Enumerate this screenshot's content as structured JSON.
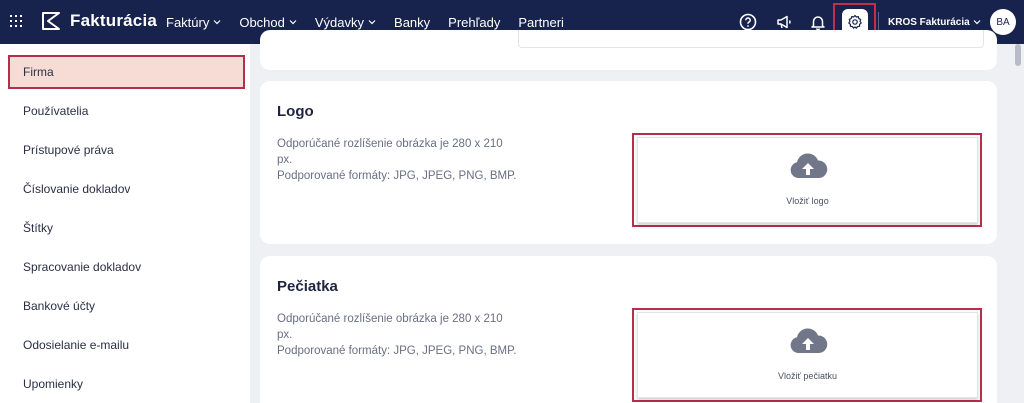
{
  "brand": {
    "name": "Fakturácia"
  },
  "nav": [
    {
      "label": "Faktúry",
      "dropdown": true
    },
    {
      "label": "Obchod",
      "dropdown": true
    },
    {
      "label": "Výdavky",
      "dropdown": true
    },
    {
      "label": "Banky",
      "dropdown": false
    },
    {
      "label": "Prehľady",
      "dropdown": false
    },
    {
      "label": "Partneri",
      "dropdown": false
    }
  ],
  "toolbar": {
    "icons": [
      "help-icon",
      "megaphone-icon",
      "bell-icon",
      "gear-icon"
    ],
    "company": "KROS Fakturácia",
    "avatar_initials": "BA"
  },
  "sidebar": {
    "items": [
      {
        "label": "Firma",
        "active": true
      },
      {
        "label": "Používatelia"
      },
      {
        "label": "Prístupové práva"
      },
      {
        "label": "Číslovanie dokladov"
      },
      {
        "label": "Štítky"
      },
      {
        "label": "Spracovanie dokladov"
      },
      {
        "label": "Bankové účty"
      },
      {
        "label": "Odosielanie e-mailu"
      },
      {
        "label": "Upomienky"
      }
    ]
  },
  "sections": {
    "logo": {
      "title": "Logo",
      "desc_line1": "Odporúčané rozlíšenie obrázka je 280 x 210 px.",
      "desc_line2": "Podporované formáty: JPG, JPEG, PNG, BMP.",
      "upload_label": "Vložiť logo"
    },
    "stamp": {
      "title": "Pečiatka",
      "desc_line1": "Odporúčané rozlíšenie obrázka je 280 x 210 px.",
      "desc_line2": "Podporované formáty: JPG, JPEG, PNG, BMP.",
      "upload_label": "Vložiť pečiatku"
    }
  },
  "colors": {
    "topbar": "#17224d",
    "highlight": "#b52f4c",
    "active_bg": "#f7dcd5"
  }
}
